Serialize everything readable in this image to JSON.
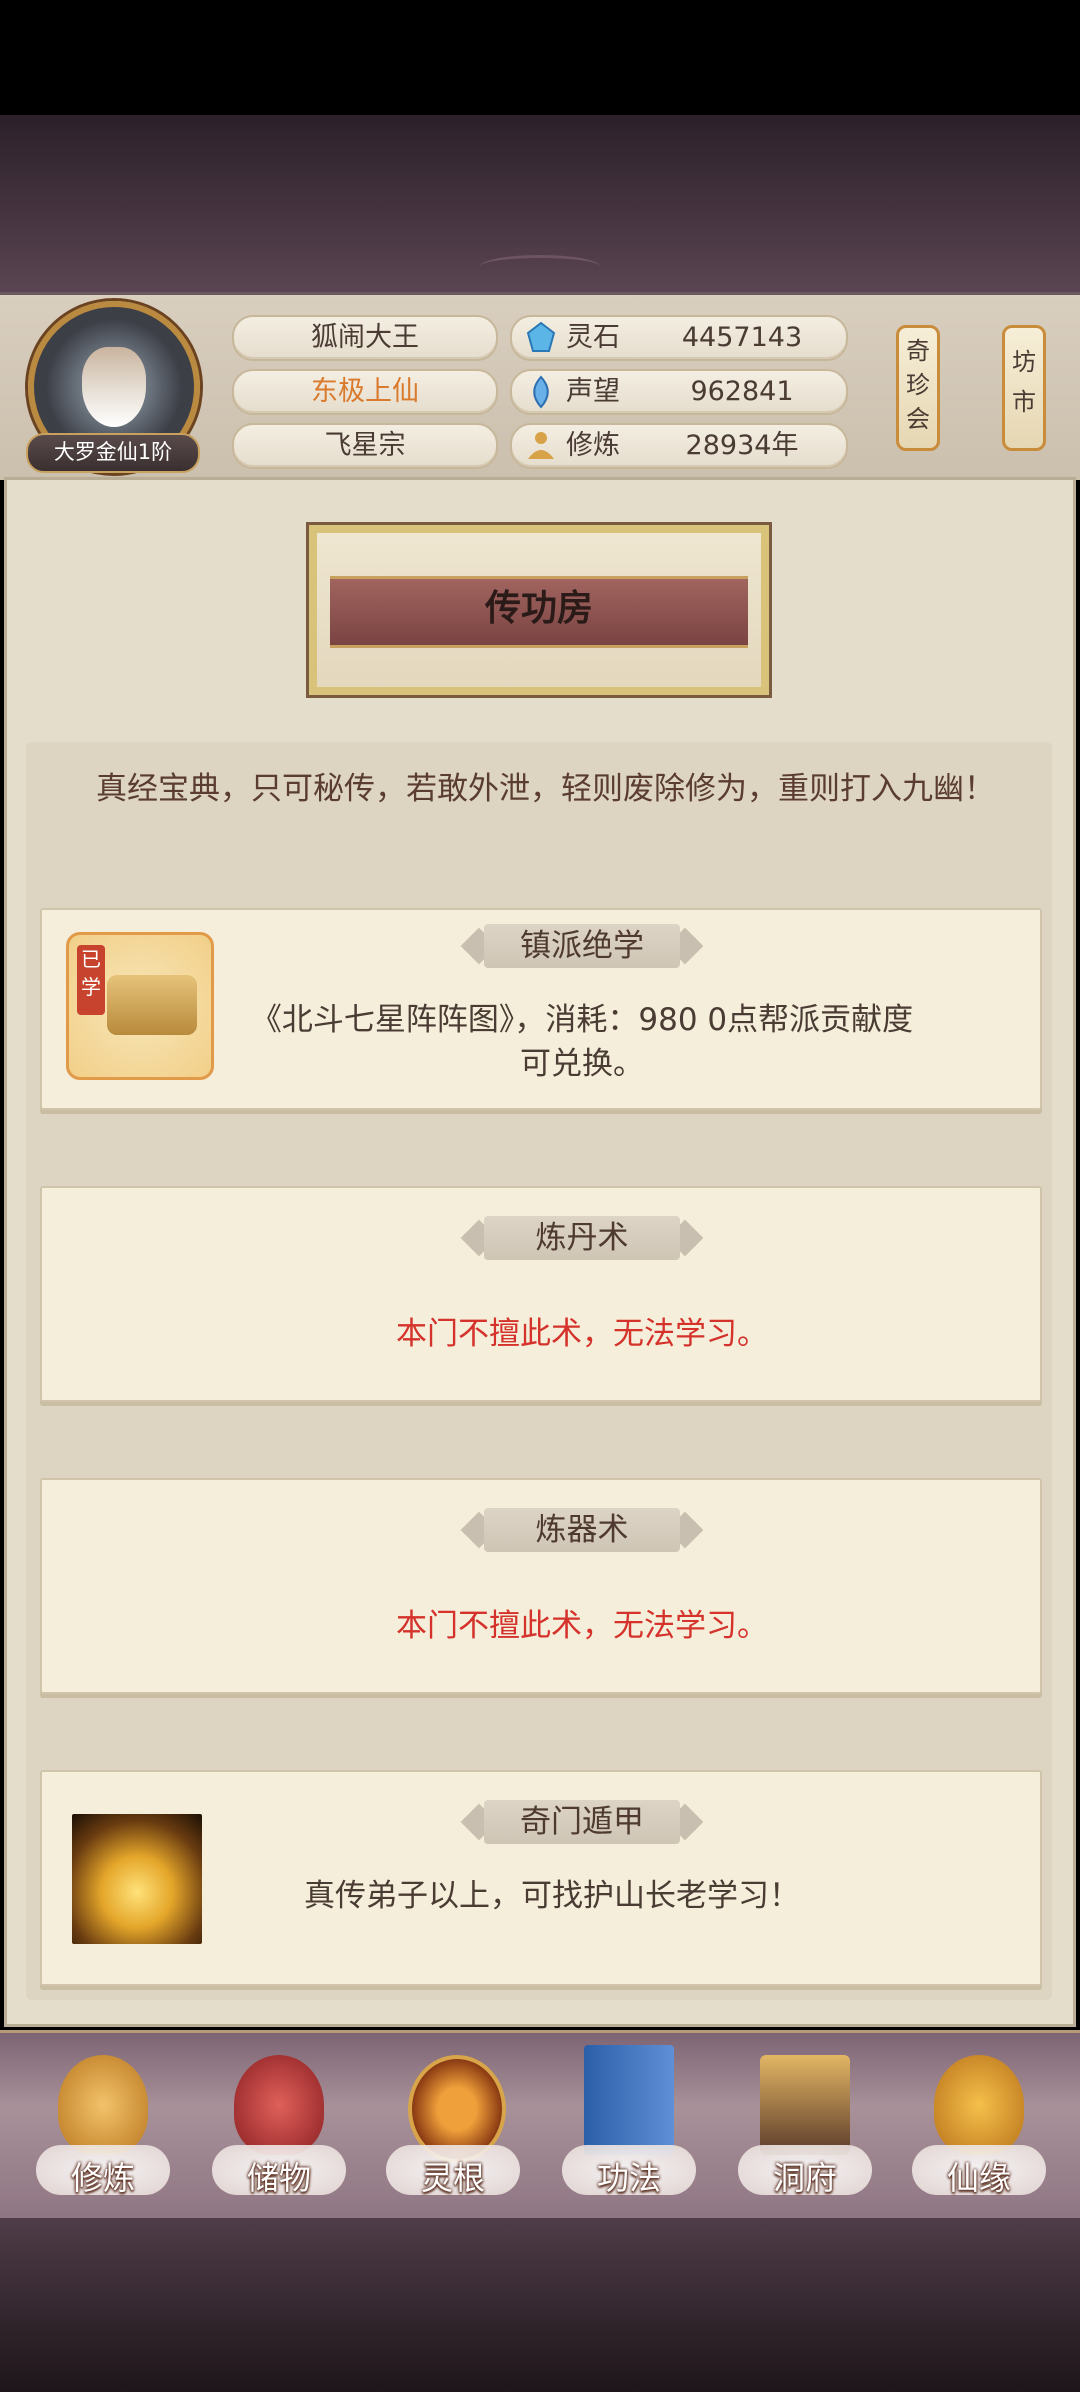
{
  "player": {
    "rank": "大罗金仙1阶",
    "name": "狐闹大王",
    "title": "东极上仙",
    "sect": "飞星宗"
  },
  "resources": [
    {
      "label": "灵石",
      "value": "4457143",
      "icon": "spirit-stone-icon"
    },
    {
      "label": "声望",
      "value": "962841",
      "icon": "prestige-icon"
    },
    {
      "label": "修炼",
      "value": "28934年",
      "icon": "meditation-icon"
    }
  ],
  "side_buttons": {
    "treasure": "奇珍会",
    "market": "坊市"
  },
  "page_title": "传功房",
  "intro": "真经宝典，只可秘传，若敢外泄，轻则废除修为，重则打入九幽！",
  "cards": [
    {
      "banner": "镇派绝学",
      "text": "《北斗七星阵阵图》，消耗：980 0点帮派贡献度可兑换。",
      "badge": "已学"
    },
    {
      "banner": "炼丹术",
      "text": "本门不擅此术，无法学习。"
    },
    {
      "banner": "炼器术",
      "text": "本门不擅此术，无法学习。"
    },
    {
      "banner": "奇门遁甲",
      "text": "真传弟子以上，可找护山长老学习！"
    }
  ],
  "nav": [
    {
      "label": "修炼",
      "icon": "cultivate-icon"
    },
    {
      "label": "储物",
      "icon": "storage-bag-icon"
    },
    {
      "label": "灵根",
      "icon": "spirit-root-icon"
    },
    {
      "label": "功法",
      "icon": "scripture-book-icon"
    },
    {
      "label": "洞府",
      "icon": "cave-dwelling-icon"
    },
    {
      "label": "仙缘",
      "icon": "fortune-gourd-icon"
    }
  ],
  "colors": {
    "title_highlight": "#d97a2c",
    "warning_red": "#d4322a",
    "text_brown": "#4a3b33"
  }
}
